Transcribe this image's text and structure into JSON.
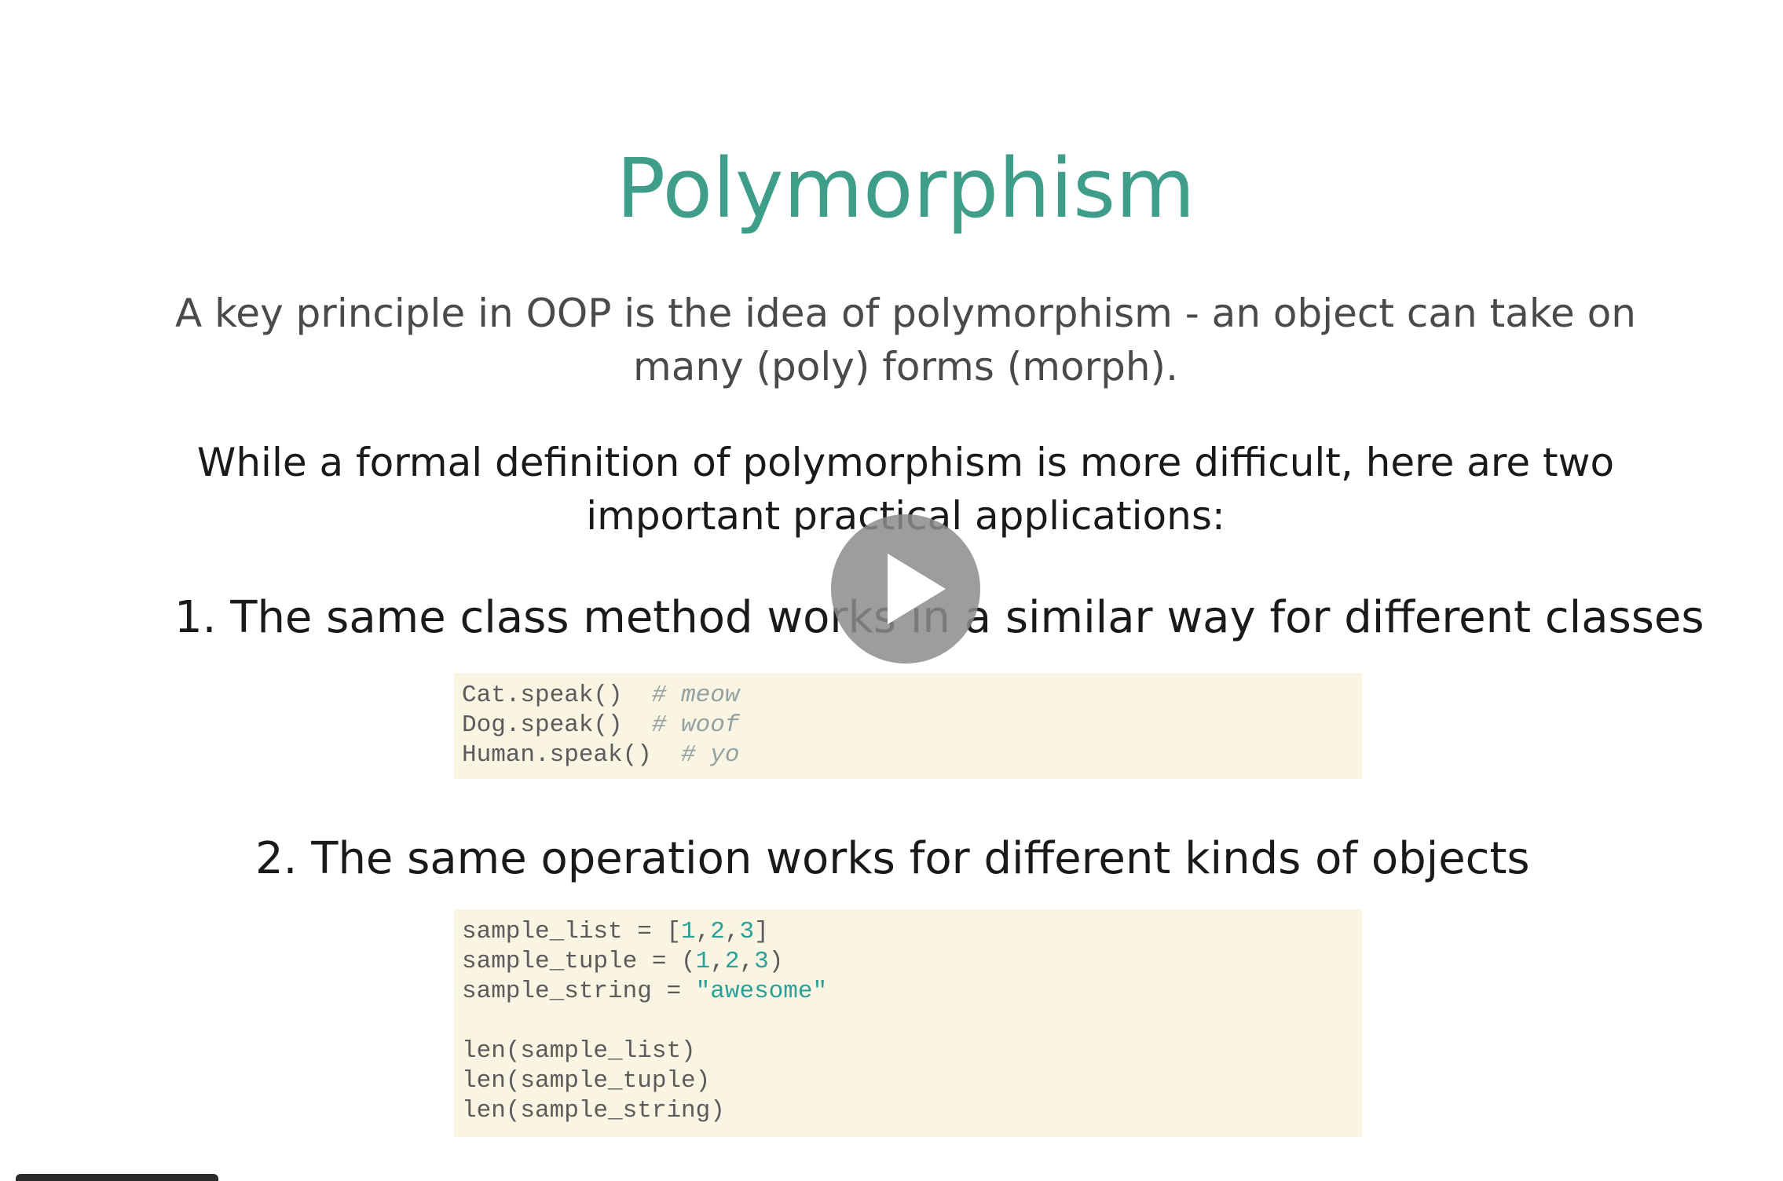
{
  "slide": {
    "title": "Polymorphism",
    "intro": {
      "line1": "A key principle in OOP is the idea of polymorphism - an object can take on",
      "line2": "many (poly) forms (morph)."
    },
    "definition": {
      "line1": "While a formal definition of polymorphism is more difficult, here are two",
      "line2": "important practical applications:"
    },
    "item1": "1. The same class method works in a similar way for different classes",
    "item2": "2. The same operation works for different kinds of objects"
  },
  "code_block_1": {
    "lines": [
      {
        "code": "Cat.speak()  ",
        "comment": "# meow"
      },
      {
        "code": "Dog.speak()  ",
        "comment": "# woof"
      },
      {
        "code": "Human.speak()  ",
        "comment": "# yo"
      }
    ]
  },
  "code_block_2": {
    "list_prefix": "sample_list = [",
    "list_n1": "1",
    "list_sep1": ",",
    "list_n2": "2",
    "list_sep2": ",",
    "list_n3": "3",
    "list_suffix": "]",
    "tuple_prefix": "sample_tuple = (",
    "tuple_n1": "1",
    "tuple_sep1": ",",
    "tuple_n2": "2",
    "tuple_sep2": ",",
    "tuple_n3": "3",
    "tuple_suffix": ")",
    "string_prefix": "sample_string = ",
    "string_value": "\"awesome\"",
    "len_lines": [
      "len(sample_list)",
      "len(sample_tuple)",
      "len(sample_string)"
    ]
  },
  "player": {
    "play_icon": "play-icon"
  },
  "colors": {
    "title": "#3e9e8a",
    "code_background": "#faf4e2",
    "literal": "#2aa198",
    "comment": "#93a1a1"
  }
}
